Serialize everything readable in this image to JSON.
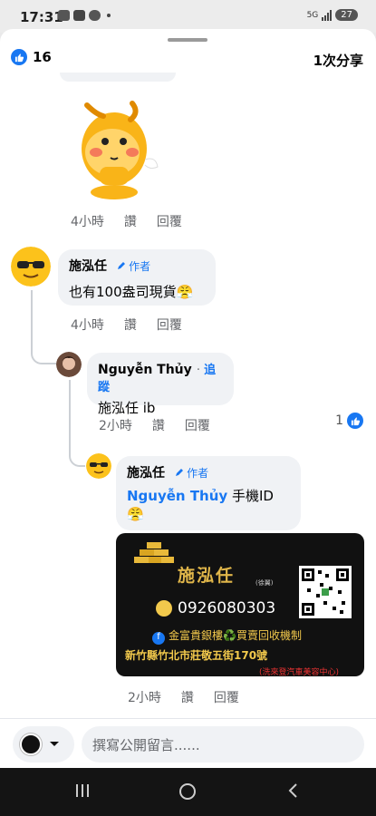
{
  "status": {
    "time": "17:31",
    "network": "5G",
    "battery": "27"
  },
  "header": {
    "reaction_count": "16",
    "share_count": "1次分享"
  },
  "comments": [
    {
      "time": "4小時",
      "like": "讚",
      "reply": "回覆"
    },
    {
      "name": "施泓任",
      "badge": "作者",
      "text": "也有100盎司現貨😤",
      "time": "4小時",
      "like": "讚",
      "reply": "回覆"
    },
    {
      "name": "Nguyễn Thủy",
      "follow": "追蹤",
      "text": "施泓任 ib",
      "time": "2小時",
      "like": "讚",
      "reply": "回覆",
      "likes": "1"
    },
    {
      "name": "施泓任",
      "badge": "作者",
      "mention": "Nguyễn Thủy",
      "text": " 手機ID",
      "emoji": "😤",
      "time": "2小時",
      "like": "讚",
      "reply": "回覆"
    }
  ],
  "image_card": {
    "name": "施泓任",
    "small": "(徐翼)",
    "phone": "0926080303",
    "line1": "金富貴銀樓♻️買賣回收機制",
    "line2": "新竹縣竹北市莊敬五街170號",
    "line3": "(洗來登汽車美容中心)"
  },
  "composer": {
    "placeholder": "撰寫公開留言......"
  },
  "colors": {
    "accent": "#1877f2",
    "bubble": "#f0f2f5"
  }
}
